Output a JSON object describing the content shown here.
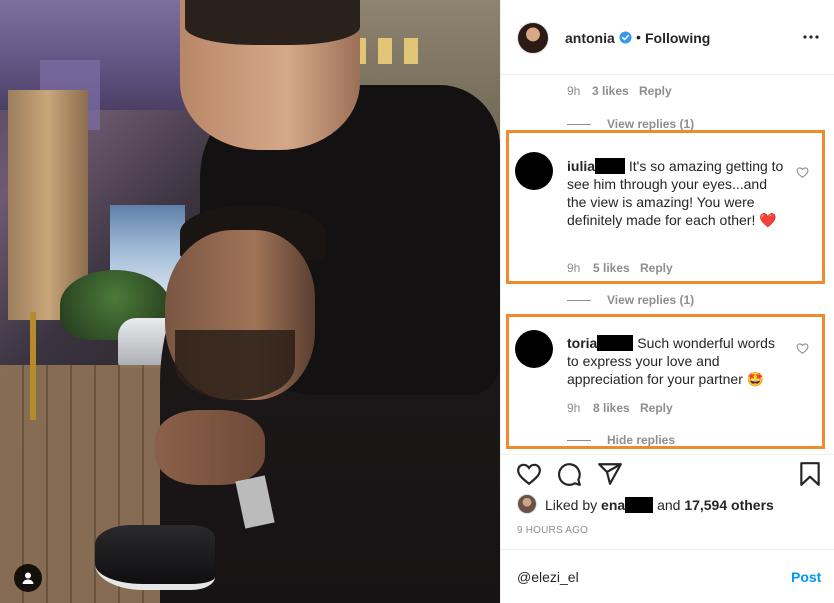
{
  "post": {
    "username": "antonia",
    "separator": "•",
    "follow_status": "Following",
    "more_icon": "more-horizontal-icon"
  },
  "top_comment_meta": {
    "time": "9h",
    "likes": "3 likes",
    "reply": "Reply",
    "view_replies": "View replies (1)"
  },
  "comments": [
    {
      "username": "iulia",
      "text": "It's so amazing getting to see him through your eyes...and the view is amazing! You were definitely made for each other!",
      "emoji": "❤️",
      "time": "9h",
      "likes": "5 likes",
      "reply": "Reply",
      "replies_toggle": "View replies (1)"
    },
    {
      "username": "toria",
      "text": "Such wonderful words to express your love and appreciation for your partner",
      "emoji": "🤩",
      "time": "9h",
      "likes": "8 likes",
      "reply": "Reply",
      "replies_toggle": "Hide replies"
    }
  ],
  "liked_by": {
    "prefix": "Liked by",
    "user": "ena",
    "and": "and",
    "others": "17,594 others"
  },
  "timestamp": "9 HOURS AGO",
  "comment_input": {
    "value": "@elezi_el",
    "post_label": "Post"
  },
  "colors": {
    "highlight": "#f08a2c",
    "link_blue": "#0095f6",
    "verified_blue": "#3897f0",
    "muted": "#8e8e8e"
  }
}
